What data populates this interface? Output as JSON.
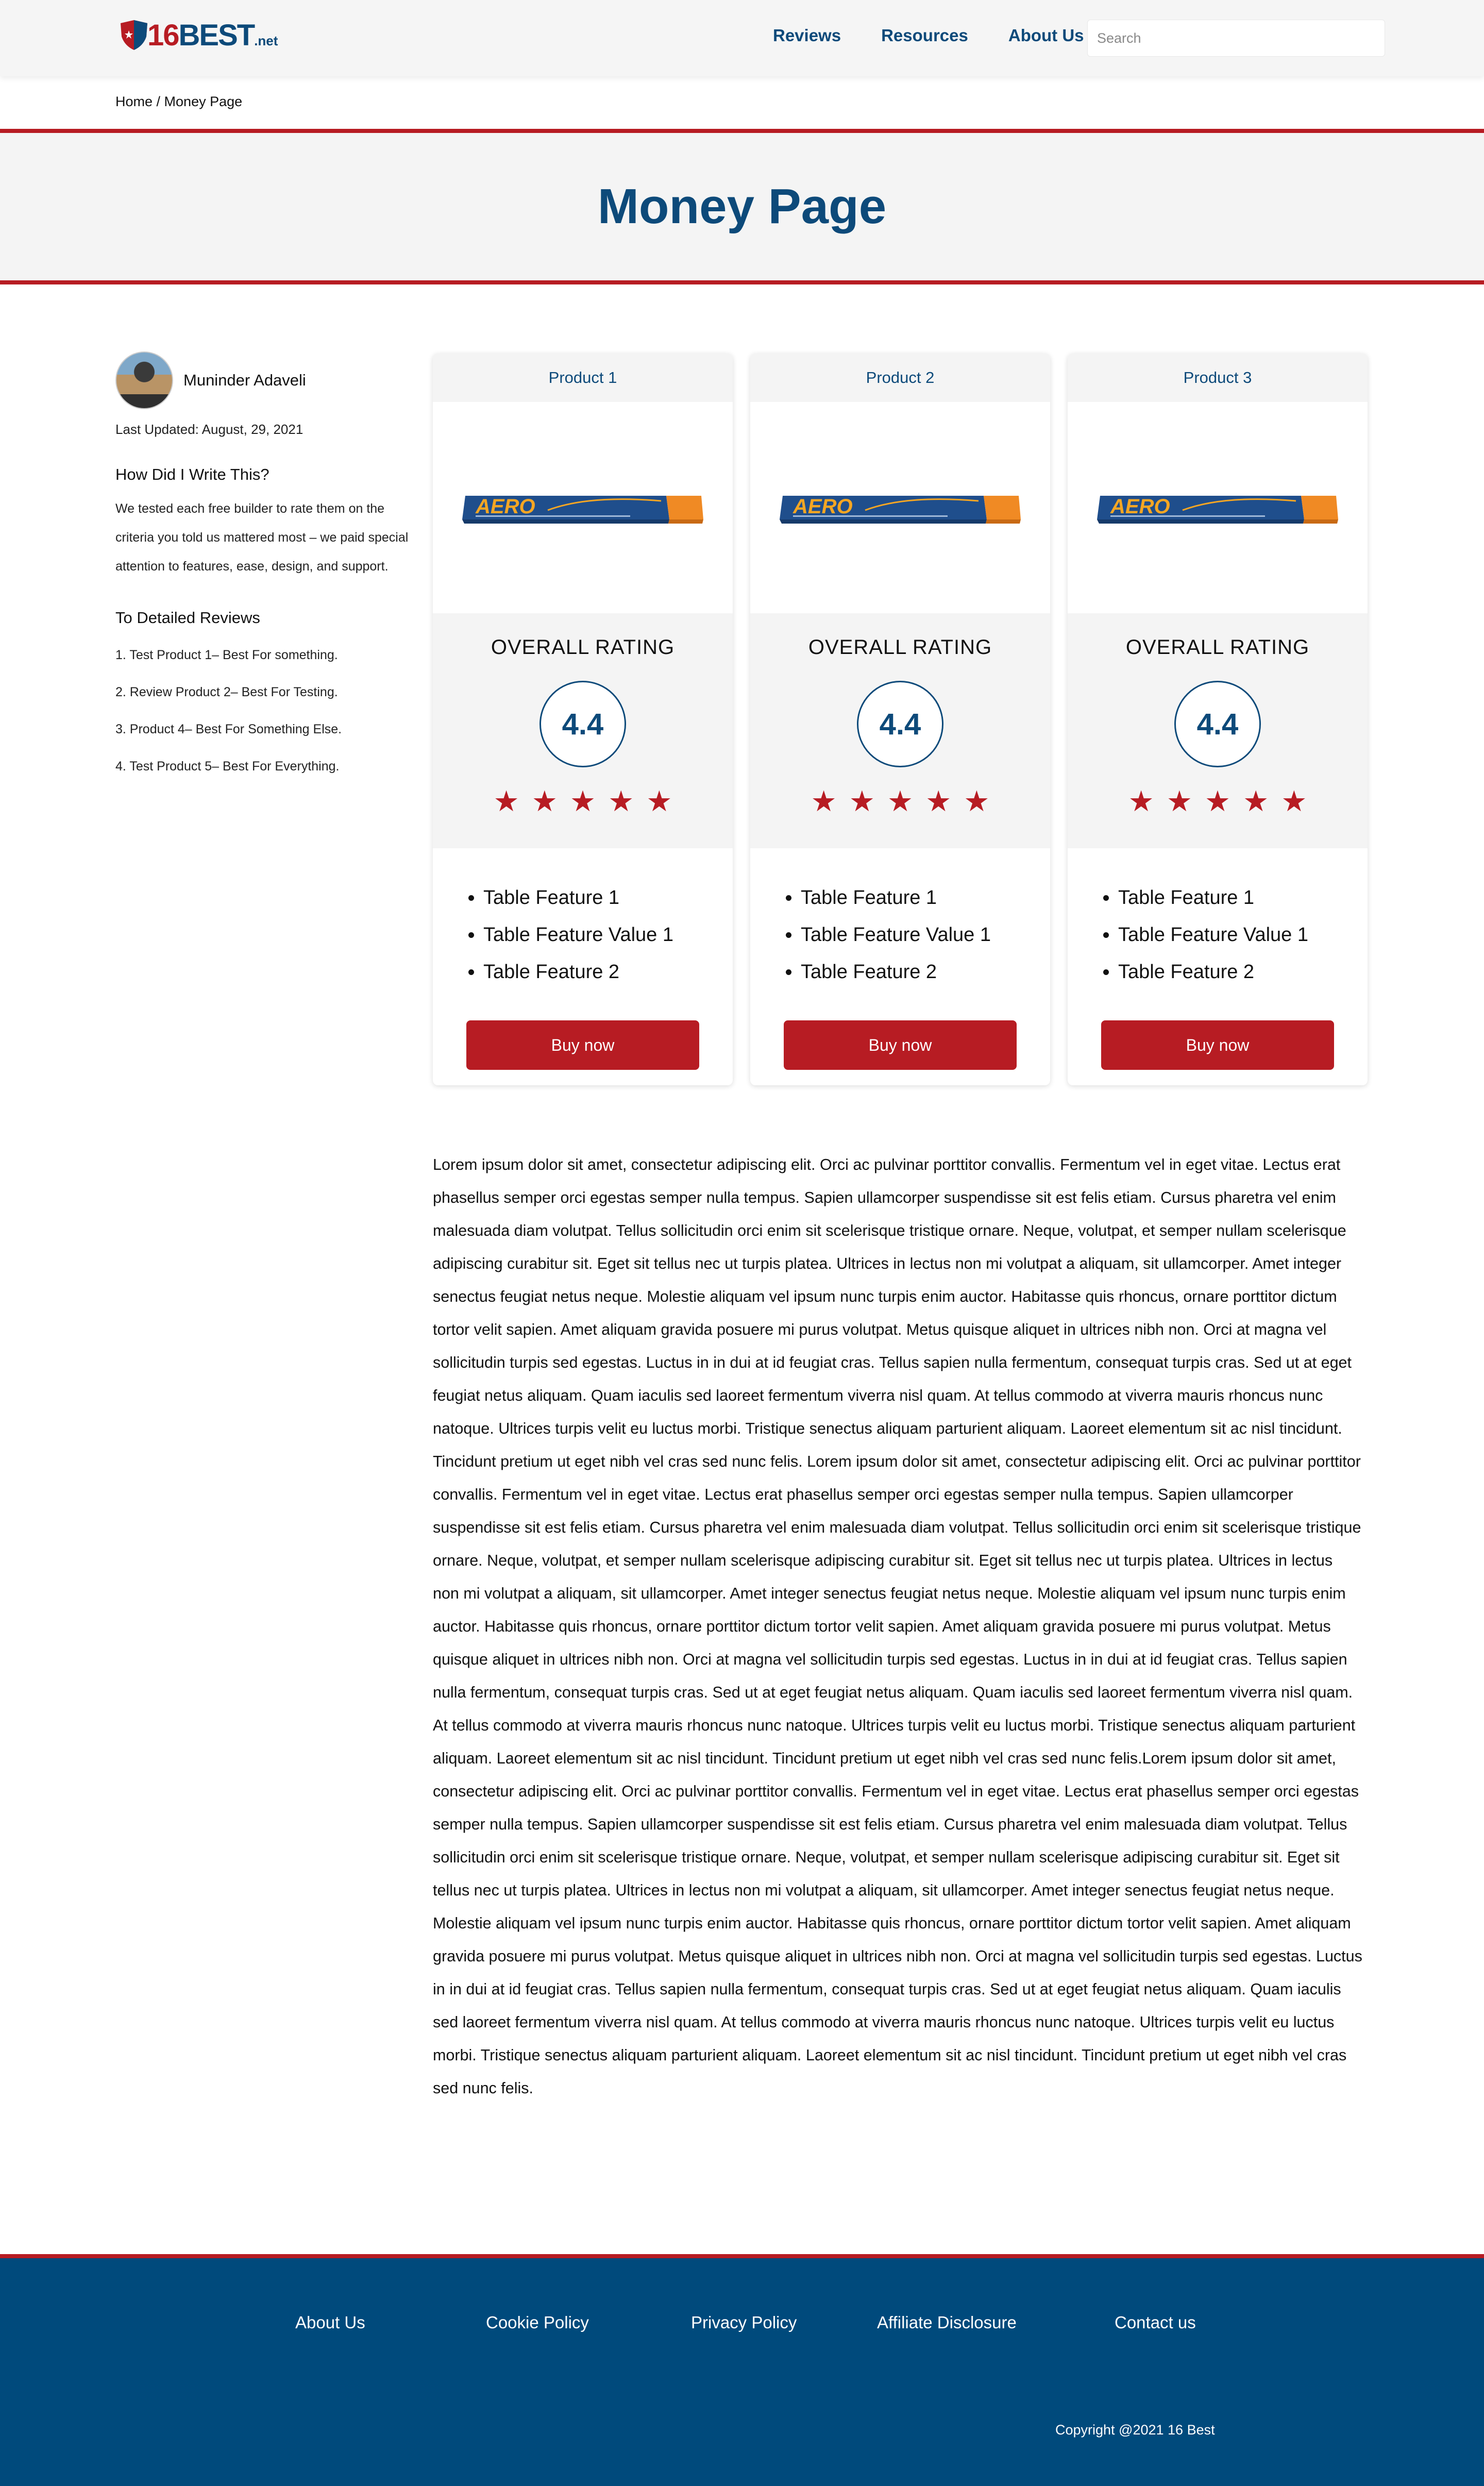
{
  "header": {
    "logo": {
      "number": "16",
      "word": "BEST",
      "tld": ".net"
    },
    "nav": [
      {
        "label": "Reviews"
      },
      {
        "label": "Resources"
      },
      {
        "label": "About Us"
      }
    ],
    "search_placeholder": "Search"
  },
  "breadcrumb": {
    "home": "Home",
    "separator": " / ",
    "current": "Money Page"
  },
  "hero": {
    "title": "Money Page"
  },
  "sidebar": {
    "author_name": "Muninder Adaveli",
    "last_updated": "Last Updated: August, 29, 2021",
    "how_heading": "How Did I Write This?",
    "how_text": "We tested each free builder to rate them on the criteria you told us mattered most – we paid special attention to features, ease, design, and support.",
    "reviews_heading": "To Detailed Reviews",
    "reviews": [
      {
        "label": "1. Test Product 1– Best For something."
      },
      {
        "label": "2. Review Product 2– Best For Testing."
      },
      {
        "label": "3. Product 4– Best For Something Else."
      },
      {
        "label": "4. Test Product 5– Best For Everything."
      }
    ]
  },
  "products": [
    {
      "name": "Product 1",
      "image_text": "AERO",
      "rating_title": "OVERALL RATING",
      "rating": "4.4",
      "stars": 5,
      "features": [
        "Table Feature 1",
        "Table Feature Value 1",
        "Table Feature 2"
      ],
      "button": "Buy now"
    },
    {
      "name": "Product 2",
      "image_text": "AERO",
      "rating_title": "OVERALL RATING",
      "rating": "4.4",
      "stars": 5,
      "features": [
        "Table Feature 1",
        "Table Feature Value 1",
        "Table Feature 2"
      ],
      "button": "Buy now"
    },
    {
      "name": "Product 3",
      "image_text": "AERO",
      "rating_title": "OVERALL RATING",
      "rating": "4.4",
      "stars": 5,
      "features": [
        "Table Feature 1",
        "Table Feature Value 1",
        "Table Feature 2"
      ],
      "button": "Buy now"
    }
  ],
  "body_text": "Lorem ipsum dolor sit amet, consectetur adipiscing elit. Orci ac pulvinar porttitor convallis. Fermentum vel in eget vitae. Lectus erat phasellus semper orci egestas semper nulla tempus. Sapien ullamcorper suspendisse sit est felis etiam. Cursus pharetra vel enim malesuada diam volutpat. Tellus sollicitudin orci enim sit scelerisque tristique ornare. Neque, volutpat, et semper nullam scelerisque adipiscing curabitur sit. Eget sit tellus nec ut turpis platea. Ultrices in lectus non mi volutpat a aliquam, sit ullamcorper. Amet integer senectus feugiat netus neque. Molestie aliquam vel ipsum nunc turpis enim auctor. Habitasse quis rhoncus, ornare porttitor dictum tortor velit sapien. Amet aliquam gravida posuere mi purus volutpat. Metus quisque aliquet in ultrices nibh non. Orci at magna vel sollicitudin turpis sed egestas. Luctus in in dui at id feugiat cras. Tellus sapien nulla fermentum, consequat turpis cras. Sed ut at eget feugiat netus aliquam. Quam iaculis sed laoreet fermentum viverra nisl quam. At tellus commodo at viverra mauris rhoncus nunc natoque. Ultrices turpis velit eu luctus morbi. Tristique senectus aliquam parturient aliquam. Laoreet elementum sit ac nisl tincidunt. Tincidunt pretium ut eget nibh vel cras sed nunc felis. Lorem ipsum dolor sit amet, consectetur adipiscing elit. Orci ac pulvinar porttitor convallis. Fermentum vel in eget vitae. Lectus erat phasellus semper orci egestas semper nulla tempus. Sapien ullamcorper suspendisse sit est felis etiam. Cursus pharetra vel enim malesuada diam volutpat. Tellus sollicitudin orci enim sit scelerisque tristique ornare. Neque, volutpat, et semper nullam scelerisque adipiscing curabitur sit. Eget sit tellus nec ut turpis platea. Ultrices in lectus non mi volutpat a aliquam, sit ullamcorper. Amet integer senectus feugiat netus neque. Molestie aliquam vel ipsum nunc turpis enim auctor. Habitasse quis rhoncus, ornare porttitor dictum tortor velit sapien. Amet aliquam gravida posuere mi purus volutpat. Metus quisque aliquet in ultrices nibh non. Orci at magna vel sollicitudin turpis sed egestas. Luctus in in dui at id feugiat cras. Tellus sapien nulla fermentum, consequat turpis cras. Sed ut at eget feugiat netus aliquam. Quam iaculis sed laoreet fermentum viverra nisl quam. At tellus commodo at viverra mauris rhoncus nunc natoque. Ultrices turpis velit eu luctus morbi. Tristique senectus aliquam parturient aliquam. Laoreet elementum sit ac nisl tincidunt. Tincidunt pretium ut eget nibh vel cras sed nunc felis.Lorem ipsum dolor sit amet, consectetur adipiscing elit. Orci ac pulvinar porttitor convallis. Fermentum vel in eget vitae. Lectus erat phasellus semper orci egestas semper nulla tempus. Sapien ullamcorper suspendisse sit est felis etiam. Cursus pharetra vel enim malesuada diam volutpat. Tellus sollicitudin orci enim sit scelerisque tristique ornare. Neque, volutpat, et semper nullam scelerisque adipiscing curabitur sit. Eget sit tellus nec ut turpis platea. Ultrices in lectus non mi volutpat a aliquam, sit ullamcorper. Amet integer senectus feugiat netus neque. Molestie aliquam vel ipsum nunc turpis enim auctor. Habitasse quis rhoncus, ornare porttitor dictum tortor velit sapien. Amet aliquam gravida posuere mi purus volutpat. Metus quisque aliquet in ultrices nibh non. Orci at magna vel sollicitudin turpis sed egestas. Luctus in in dui at id feugiat cras. Tellus sapien nulla fermentum, consequat turpis cras. Sed ut at eget feugiat netus aliquam. Quam iaculis sed laoreet fermentum viverra nisl quam. At tellus commodo at viverra mauris rhoncus nunc natoque. Ultrices turpis velit eu luctus morbi. Tristique senectus aliquam parturient aliquam. Laoreet elementum sit ac nisl tincidunt. Tincidunt pretium ut eget nibh vel cras sed nunc felis.",
  "footer": {
    "links": [
      {
        "label": "About Us"
      },
      {
        "label": "Cookie Policy"
      },
      {
        "label": "Privacy Policy"
      },
      {
        "label": "Affiliate Disclosure"
      },
      {
        "label": "Contact us"
      }
    ],
    "copyright": "Copyright @2021 16 Best"
  },
  "colors": {
    "brand_blue": "#0d4a7a",
    "brand_red": "#b71c23",
    "footer_bg": "#004a7c",
    "panel_gray": "#f4f4f4"
  },
  "icons": {
    "star": "star-icon",
    "logo": "shield-logo-icon"
  }
}
